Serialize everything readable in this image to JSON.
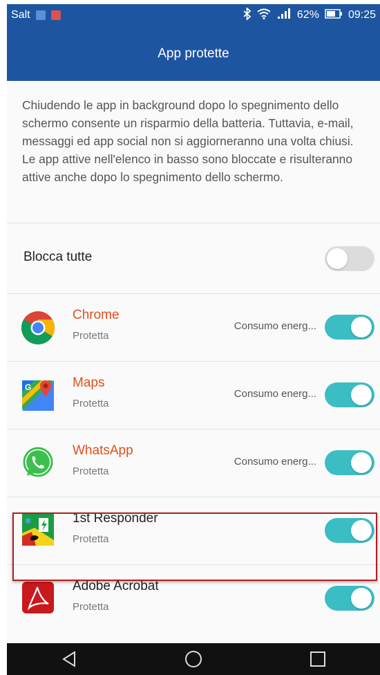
{
  "status_bar": {
    "carrier": "Salt",
    "battery": "62%",
    "time": "09:25"
  },
  "header": {
    "title": "App protette"
  },
  "description": {
    "p1": "Chiudendo le app in background dopo lo spegnimento dello schermo consente un risparmio della batteria. Tuttavia, e-mail, messaggi ed app social non si aggiorneranno una volta chiusi.",
    "p2": "Le app attive nell'elenco in basso sono bloccate e risulteranno attive anche dopo lo spegnimento dello schermo."
  },
  "block_all": {
    "label": "Blocca tutte",
    "enabled": false
  },
  "apps": [
    {
      "name": "Chrome",
      "status": "Protetta",
      "consumo": "Consumo energ...",
      "enabled": true,
      "icon": "chrome-icon"
    },
    {
      "name": "Maps",
      "status": "Protetta",
      "consumo": "Consumo energ...",
      "enabled": true,
      "icon": "maps-icon"
    },
    {
      "name": "WhatsApp",
      "status": "Protetta",
      "consumo": "Consumo energ...",
      "enabled": true,
      "icon": "whatsapp-icon"
    },
    {
      "name": "1st Responder",
      "status": "Protetta",
      "enabled": true,
      "icon": "first-responder-icon"
    },
    {
      "name": "Adobe Acrobat",
      "status": "Protetta",
      "enabled": true,
      "icon": "adobe-acrobat-icon"
    }
  ],
  "colors": {
    "app_bar": "#1e55a0",
    "toggle_on": "#3bbdc4",
    "app_name_highlight": "#e0501c",
    "highlight_border": "#b21e1e"
  }
}
